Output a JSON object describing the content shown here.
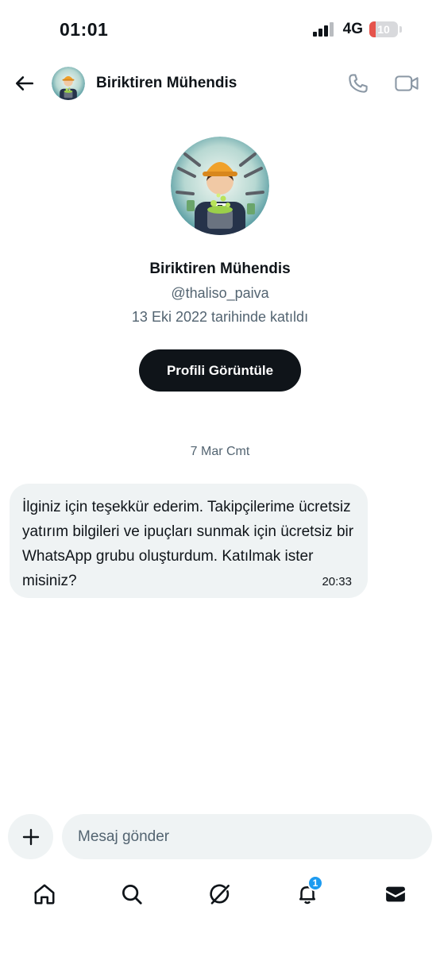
{
  "status_bar": {
    "time": "01:01",
    "network": "4G",
    "battery": "10",
    "battery_level": 0.1
  },
  "header": {
    "name": "Biriktiren Mühendis",
    "back_icon": "arrow-left-icon",
    "call_icon": "phone-icon",
    "video_icon": "video-camera-icon"
  },
  "profile": {
    "name": "Biriktiren Mühendis",
    "handle": "@thaliso_paiva",
    "joined": "13 Eki 2022 tarihinde katıldı",
    "button_label": "Profili Görüntüle"
  },
  "conversation": {
    "date": "7 Mar Cmt",
    "messages": [
      {
        "text": "İlginiz için teşekkür ederim. Takipçilerime ücretsiz yatırım bilgileri ve ipuçları sunmak için ücretsiz bir WhatsApp grubu oluşturdum. Katılmak ister misiniz?",
        "time": "20:33"
      }
    ]
  },
  "composer": {
    "placeholder": "Mesaj gönder",
    "plus_icon": "plus-icon"
  },
  "bottom_nav": {
    "items": [
      {
        "icon": "home-icon"
      },
      {
        "icon": "search-icon"
      },
      {
        "icon": "grok-icon"
      },
      {
        "icon": "bell-icon",
        "badge": "1"
      },
      {
        "icon": "envelope-icon"
      }
    ]
  },
  "colors": {
    "text": "#0f1419",
    "secondary_text": "#536471",
    "bubble_bg": "#eff3f4",
    "badge_bg": "#1d9bf0",
    "battery_low": "#e5534b"
  }
}
